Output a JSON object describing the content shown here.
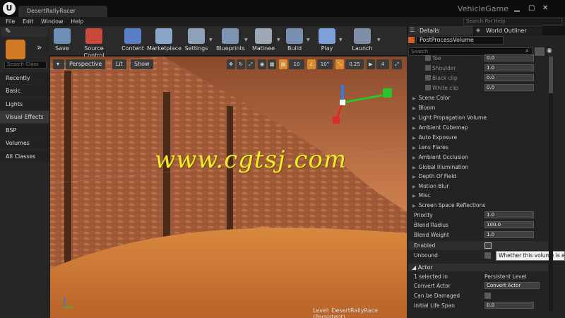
{
  "title_bar": {
    "project_tab": "DesertRallyRacer",
    "app_title": "VehicleGame",
    "logo": "U"
  },
  "menu": [
    "File",
    "Edit",
    "Window",
    "Help"
  ],
  "help_search_placeholder": "Search For Help",
  "toolbar": [
    {
      "label": "Save",
      "icon": "save-icon",
      "color": "#6f8fb8"
    },
    {
      "label": "Source Control",
      "icon": "source-control-icon",
      "color": "#c94a3a"
    },
    {
      "label": "Content",
      "icon": "content-icon",
      "color": "#5b7ec9"
    },
    {
      "label": "Marketplace",
      "icon": "marketplace-icon",
      "color": "#8aa6c9"
    },
    {
      "label": "Settings",
      "icon": "settings-icon",
      "color": "#8ea1b8"
    },
    {
      "label": "Blueprints",
      "icon": "blueprints-icon",
      "color": "#7e93b3"
    },
    {
      "label": "Matinee",
      "icon": "matinee-icon",
      "color": "#9da8b5"
    },
    {
      "label": "Build",
      "icon": "build-icon",
      "color": "#7b8fb0"
    },
    {
      "label": "Play",
      "icon": "play-icon",
      "color": "#7ea0d8"
    },
    {
      "label": "Launch",
      "icon": "launch-icon",
      "color": "#7f8fa8"
    }
  ],
  "place_mode": {
    "search_placeholder": "Search Class",
    "categories": [
      "Recently Placed",
      "Basic",
      "Lights",
      "Visual Effects",
      "BSP",
      "Volumes",
      "All Classes"
    ],
    "selected": "Visual Effects"
  },
  "viewport": {
    "buttons": [
      "Perspective",
      "Lit",
      "Show"
    ],
    "grid_snap": "10",
    "rotation_snap": "10°",
    "scale_snap": "0.25",
    "camera_speed": "4",
    "level_prefix": "Level:",
    "level_name": "DesertRallyRace (Persistent)",
    "watermark": "www.cgtsj.com"
  },
  "details": {
    "tab_label": "Details",
    "outliner_tab": "World Outliner",
    "object_name": "PostProcessVolume",
    "search_placeholder": "Search",
    "top_rows": [
      {
        "label": "Toe",
        "value": "0.0"
      },
      {
        "label": "Shoulder",
        "value": "1.0"
      },
      {
        "label": "Black clip",
        "value": "0.0"
      },
      {
        "label": "White clip",
        "value": "0.0"
      }
    ],
    "categories": [
      "Scene Color",
      "Bloom",
      "Light Propagation Volume",
      "Ambient Cubemap",
      "Auto Exposure",
      "Lens Flares",
      "Ambient Occlusion",
      "Global Illumination",
      "Depth Of Field",
      "Motion Blur",
      "Misc",
      "Screen Space Reflections"
    ],
    "props": [
      {
        "label": "Priority",
        "value": "1.0"
      },
      {
        "label": "Blend Radius",
        "value": "100.0"
      },
      {
        "label": "Blend Weight",
        "value": "1.0"
      }
    ],
    "enabled_label": "Enabled",
    "unbound_label": "Unbound",
    "tooltip": "Whether this volume is enab",
    "actor_section": "Actor",
    "actor_rows": [
      {
        "label": "1 selected in",
        "value": "Persistent Level"
      },
      {
        "label": "Convert Actor",
        "value": "Convert Actor"
      },
      {
        "label": "Can be Damaged",
        "value": ""
      },
      {
        "label": "Initial Life Span",
        "value": "0.0"
      }
    ]
  }
}
